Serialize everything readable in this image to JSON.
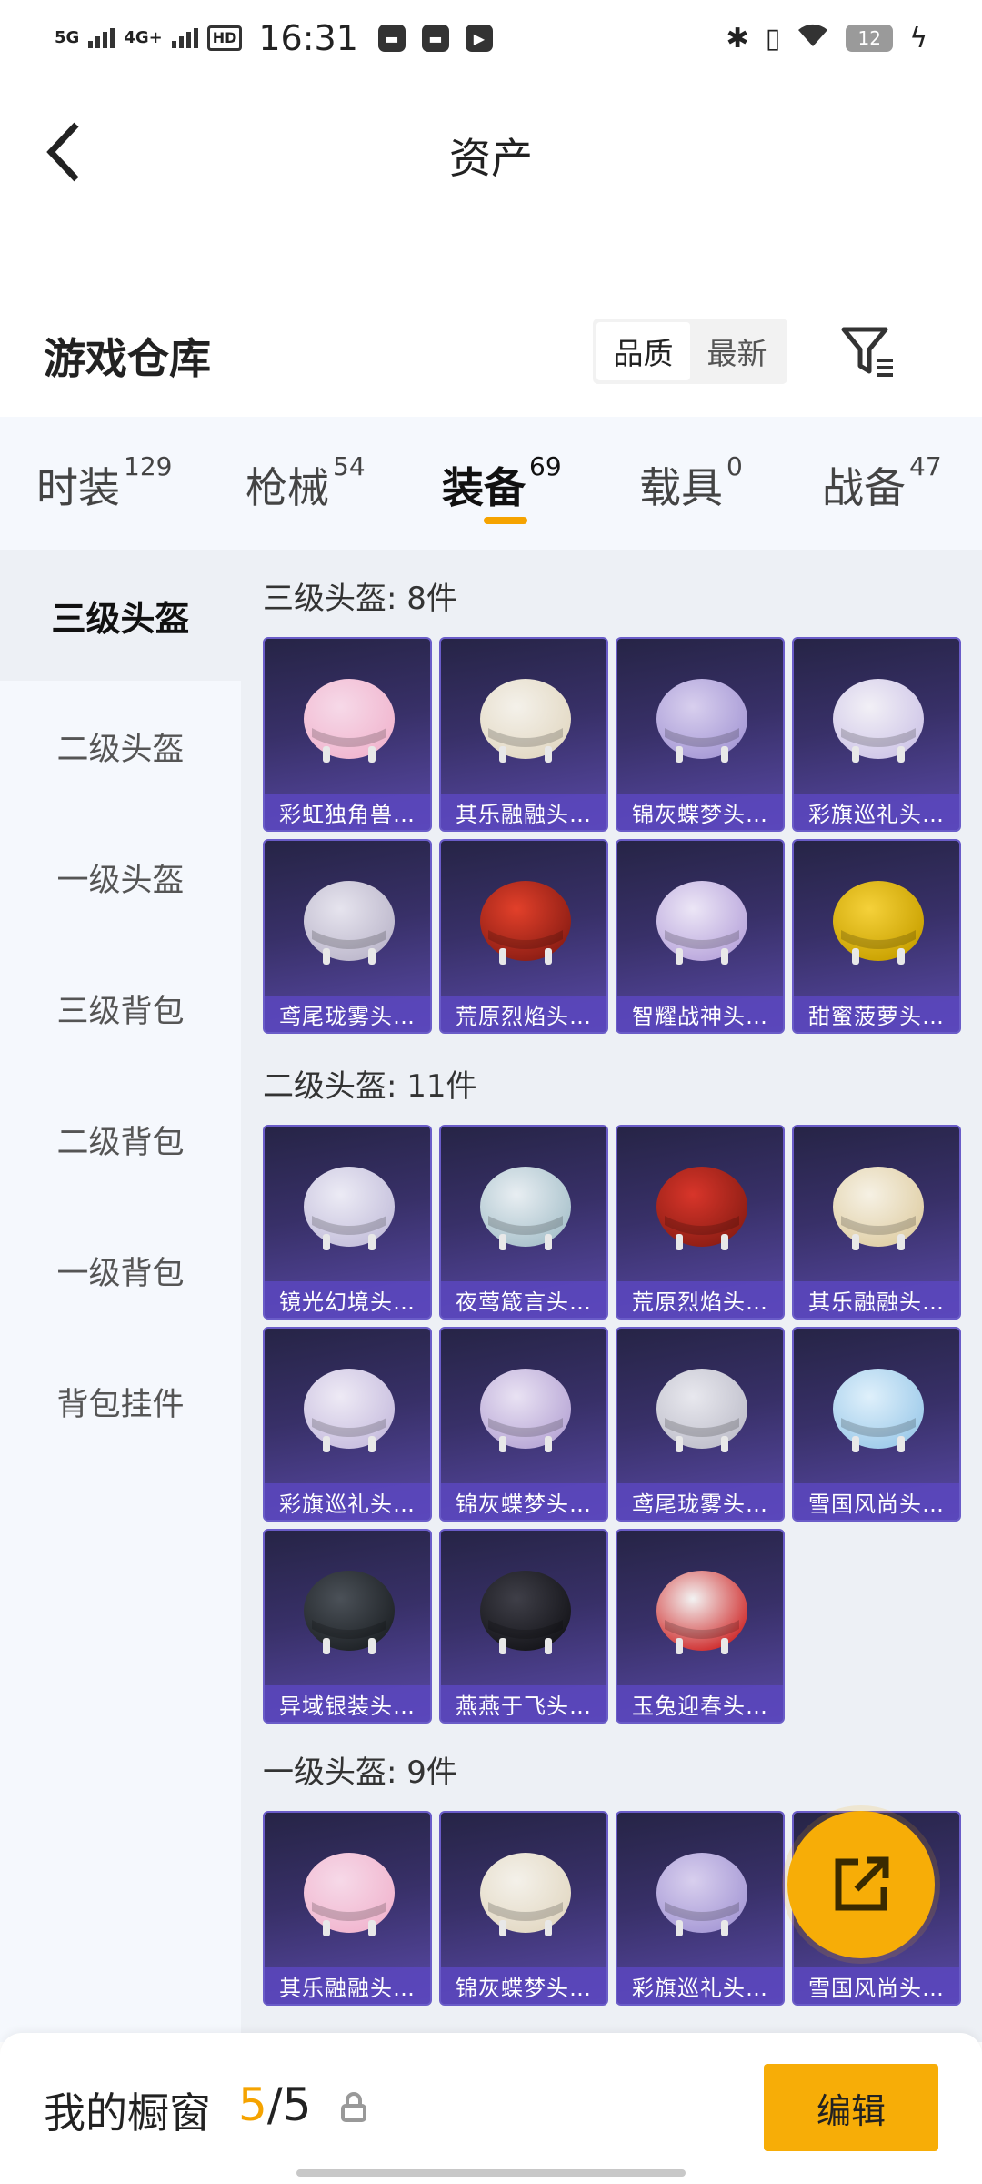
{
  "status": {
    "net1": "5G",
    "net2": "4G+",
    "hd": "HD",
    "time": "16:31",
    "battery": "12"
  },
  "header": {
    "title": "资产",
    "section_title": "游戏仓库",
    "sort_options": [
      "品质",
      "最新"
    ],
    "active_sort": "品质"
  },
  "tabs": [
    {
      "label": "时装",
      "count": "129"
    },
    {
      "label": "枪械",
      "count": "54"
    },
    {
      "label": "装备",
      "count": "69"
    },
    {
      "label": "载具",
      "count": "0"
    },
    {
      "label": "战备",
      "count": "47"
    }
  ],
  "active_tab": "装备",
  "side_menu": [
    "三级头盔",
    "二级头盔",
    "一级头盔",
    "三级背包",
    "二级背包",
    "一级背包",
    "背包挂件"
  ],
  "active_side": "三级头盔",
  "groups": [
    {
      "title": "三级头盔: 8件",
      "items": [
        "彩虹独角兽…",
        "其乐融融头…",
        "锦灰蝶梦头…",
        "彩旗巡礼头…",
        "鸢尾珑雾头…",
        "荒原烈焰头…",
        "智耀战神头…",
        "甜蜜菠萝头…"
      ]
    },
    {
      "title": "二级头盔: 11件",
      "items": [
        "镜光幻境头…",
        "夜莺箴言头…",
        "荒原烈焰头…",
        "其乐融融头…",
        "彩旗巡礼头…",
        "锦灰蝶梦头…",
        "鸢尾珑雾头…",
        "雪国风尚头…",
        "异域银装头…",
        "燕燕于飞头…",
        "玉兔迎春头…"
      ]
    },
    {
      "title": "一级头盔: 9件",
      "items": [
        "其乐融融头…",
        "锦灰蝶梦头…",
        "彩旗巡礼头…",
        "雪国风尚头…"
      ]
    }
  ],
  "bottom": {
    "showcase_label": "我的橱窗",
    "showcase_current": "5",
    "showcase_total": "/5",
    "edit_label": "编辑"
  },
  "colors": {
    "accent": "#f7ad07",
    "card_border": "#6a5cc8"
  }
}
